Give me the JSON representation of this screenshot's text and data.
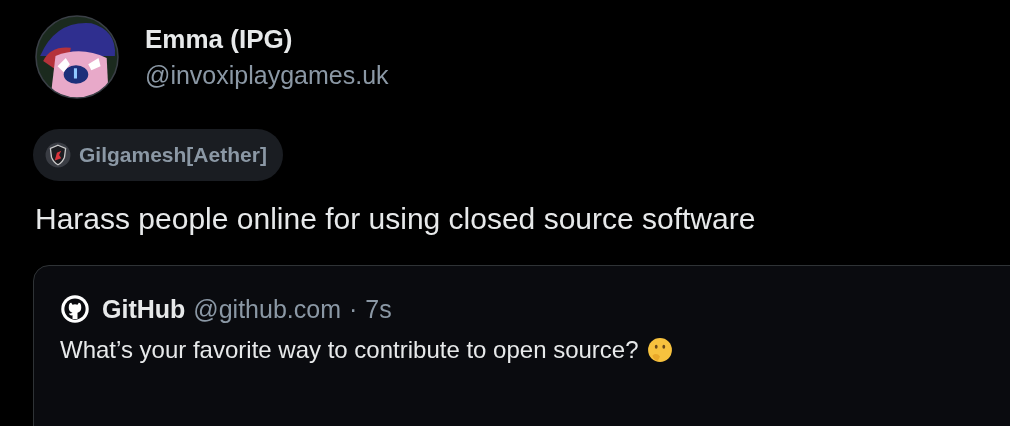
{
  "author": {
    "name": "Emma (IPG)",
    "handle": "@invoxiplaygames.uk"
  },
  "badge": {
    "label": "Gilgamesh[Aether]"
  },
  "text": "Harass people online for using closed source software",
  "quote": {
    "name": "GitHub",
    "handle": "@github.com",
    "separator": "·",
    "time": "7s",
    "text": "What’s your favorite way to contribute to open source?"
  }
}
